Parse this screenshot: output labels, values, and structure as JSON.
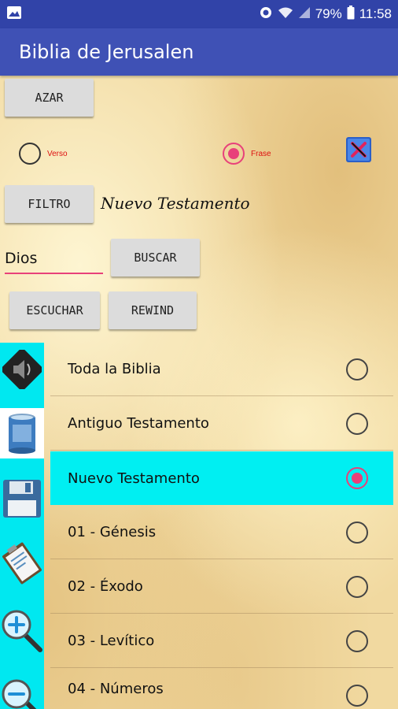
{
  "status_bar": {
    "battery": "79%",
    "time": "11:58"
  },
  "app_bar": {
    "title": "Biblia de Jerusalen"
  },
  "controls": {
    "random_button": "AZAR",
    "radio_verse_label": "Verso",
    "radio_phrase_label": "Frase",
    "filter_button": "FILTRO",
    "filter_value": "Nuevo Testamento",
    "search_value": "Dios",
    "search_button": "BUSCAR",
    "listen_button": "ESCUCHAR",
    "rewind_button": "REWIND"
  },
  "side_icons": [
    "speaker-icon",
    "trash-can-icon",
    "floppy-disk-icon",
    "clipboard-icon",
    "zoom-in-icon",
    "zoom-out-icon"
  ],
  "list": {
    "items": [
      {
        "label": "Toda la Biblia",
        "selected": false
      },
      {
        "label": "Antiguo Testamento",
        "selected": false
      },
      {
        "label": "Nuevo Testamento",
        "selected": true
      },
      {
        "label": "01 - Génesis",
        "selected": false
      },
      {
        "label": "02 - Éxodo",
        "selected": false
      },
      {
        "label": "03 - Levítico",
        "selected": false
      },
      {
        "label": "04 - Números",
        "selected": false
      }
    ]
  },
  "colors": {
    "status_bar": "#3143a8",
    "app_bar": "#3f51b5",
    "accent": "#e8417a",
    "highlight": "#00eff2"
  }
}
